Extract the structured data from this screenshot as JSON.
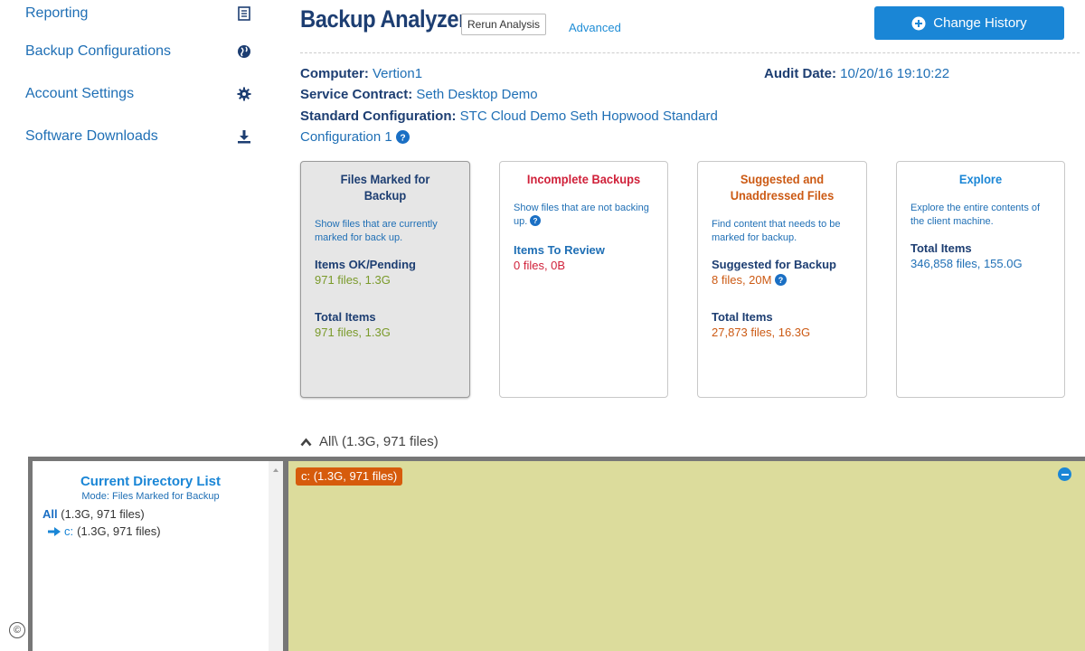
{
  "sidebar": {
    "items": [
      {
        "label": "Reporting",
        "icon": "report-icon"
      },
      {
        "label": "Backup Configurations",
        "icon": "globe-icon"
      },
      {
        "label": "Account Settings",
        "icon": "gear-icon"
      },
      {
        "label": "Software Downloads",
        "icon": "download-icon"
      }
    ]
  },
  "header": {
    "title": "Backup Analyzer",
    "rerun_label": "Rerun Analysis",
    "advanced_label": "Advanced",
    "history_label": "Change History"
  },
  "info": {
    "computer_label": "Computer:",
    "computer_value": "Vertion1",
    "contract_label": "Service Contract:",
    "contract_value": "Seth Desktop Demo",
    "config_label": "Standard Configuration:",
    "config_value_line1": "STC Cloud Demo Seth Hopwood Standard",
    "config_value_line2": "Configuration 1",
    "audit_label": "Audit Date:",
    "audit_value": "10/20/16 19:10:22"
  },
  "cards": [
    {
      "title": "Files Marked for Backup",
      "desc": "Show files that are currently marked for back up.",
      "stats": [
        {
          "label": "Items OK/Pending",
          "value": "971 files, 1.3G"
        },
        {
          "label": "Total Items",
          "value": "971 files, 1.3G"
        }
      ]
    },
    {
      "title": "Incomplete Backups",
      "desc": "Show files that are not backing up.",
      "stats": [
        {
          "label": "Items To Review",
          "value": "0 files, 0B"
        }
      ]
    },
    {
      "title": "Suggested and Unaddressed Files",
      "desc": "Find content that needs to be marked for backup.",
      "stats": [
        {
          "label": "Suggested for Backup",
          "value": "8 files, 20M"
        },
        {
          "label": "Total Items",
          "value": "27,873 files, 16.3G"
        }
      ]
    },
    {
      "title": "Explore",
      "desc": "Explore the entire contents of the client machine.",
      "stats": [
        {
          "label": "Total Items",
          "value": "346,858 files, 155.0G"
        }
      ]
    }
  ],
  "breadcrumb": "All\\ (1.3G, 971 files)",
  "directory": {
    "title": "Current Directory List",
    "mode": "Mode: Files Marked for Backup",
    "all_label": "All",
    "all_value": "(1.3G, 971 files)",
    "child_label": "c:",
    "child_value": "(1.3G, 971 files)"
  },
  "treemap": {
    "tag": "c: (1.3G, 971 files)"
  },
  "footer": {
    "copyright_symbol": "©"
  },
  "colors": {
    "link": "#1f6fb5",
    "heading": "#1d3e72",
    "primary_button": "#1a86d6",
    "green": "#7a9a2a",
    "red": "#d0213a",
    "orange": "#cc5a14",
    "treemap_fill": "#dcdc9c",
    "treemap_tag": "#d65b0c"
  }
}
